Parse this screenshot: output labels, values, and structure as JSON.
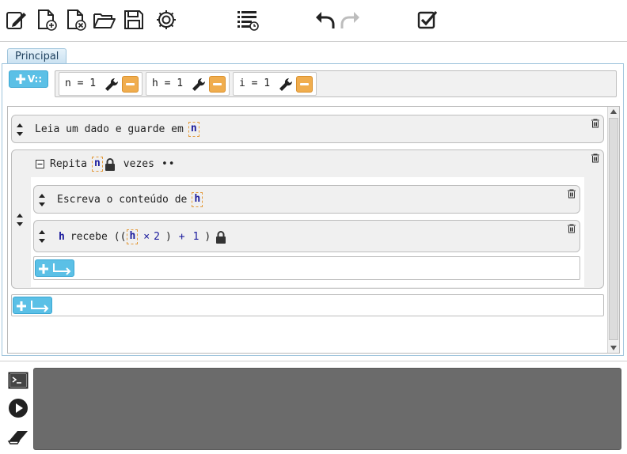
{
  "toolbar": {
    "icons": [
      "edit-icon",
      "new-file-icon",
      "close-file-icon",
      "open-folder-icon",
      "save-icon",
      "settings-icon",
      "list-history-icon",
      "undo-icon",
      "redo-icon",
      "checkbox-icon"
    ]
  },
  "tabs": [
    {
      "label": "Principal",
      "active": true
    }
  ],
  "variables": {
    "add_label": "V::",
    "items": [
      {
        "text": "n = 1"
      },
      {
        "text": "h = 1"
      },
      {
        "text": "i = 1"
      }
    ]
  },
  "program": {
    "read": {
      "label": "Leia um dado e guarde em",
      "var": "n"
    },
    "repeat": {
      "label": "Repita",
      "var": "n",
      "suffix": "vezes",
      "dots": "••",
      "write": {
        "label": "Escreva o conteúdo de",
        "var": "h"
      },
      "assign": {
        "target": "h",
        "keyword": "recebe",
        "open_paren": "((",
        "var": "h",
        "op1": "×",
        "num1": "2",
        "close1": ")",
        "op2": "+",
        "num2": "1",
        "close2": ")"
      }
    }
  },
  "colors": {
    "accent_blue": "#5bc0e6",
    "minus_orange": "#f0ad4e",
    "var_text": "#1a1a9c",
    "console_bg": "#6b6b6b"
  },
  "bottom_icons": [
    "terminal-icon",
    "play-icon",
    "eraser-icon"
  ]
}
